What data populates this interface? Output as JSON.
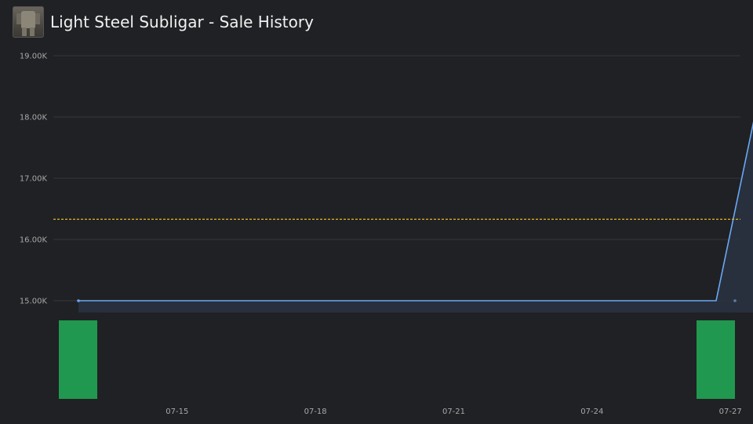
{
  "header": {
    "title": "Light Steel Subligar - Sale History",
    "icon": "armor-item-icon"
  },
  "colors": {
    "background": "#202124",
    "line": "#6aa8f5",
    "area": "#2a3342",
    "volume": "#21984f",
    "average": "#e4b923",
    "grid": "#34363a"
  },
  "chart_data": {
    "type": "line",
    "title": "Light Steel Subligar - Sale History",
    "xlabel": "",
    "ylabel": "",
    "x_ticks": [
      "07-15",
      "07-18",
      "07-21",
      "07-24",
      "07-27"
    ],
    "y_ticks": [
      "15.00K",
      "16.00K",
      "17.00K",
      "18.00K",
      "19.00K"
    ],
    "ylim": [
      14800,
      19000
    ],
    "xlim_days": [
      13.13,
      27.25
    ],
    "grid": true,
    "series": [
      {
        "points": [
          {
            "x": "07-13",
            "y": 15000
          },
          {
            "x": "07-26",
            "y": 15000
          },
          {
            "x": "07-27",
            "y": 18000
          }
        ]
      }
    ],
    "average_line": 16330,
    "volume": [
      {
        "x": "07-13",
        "y": 1
      },
      {
        "x": "07-26",
        "y": 1
      }
    ]
  }
}
